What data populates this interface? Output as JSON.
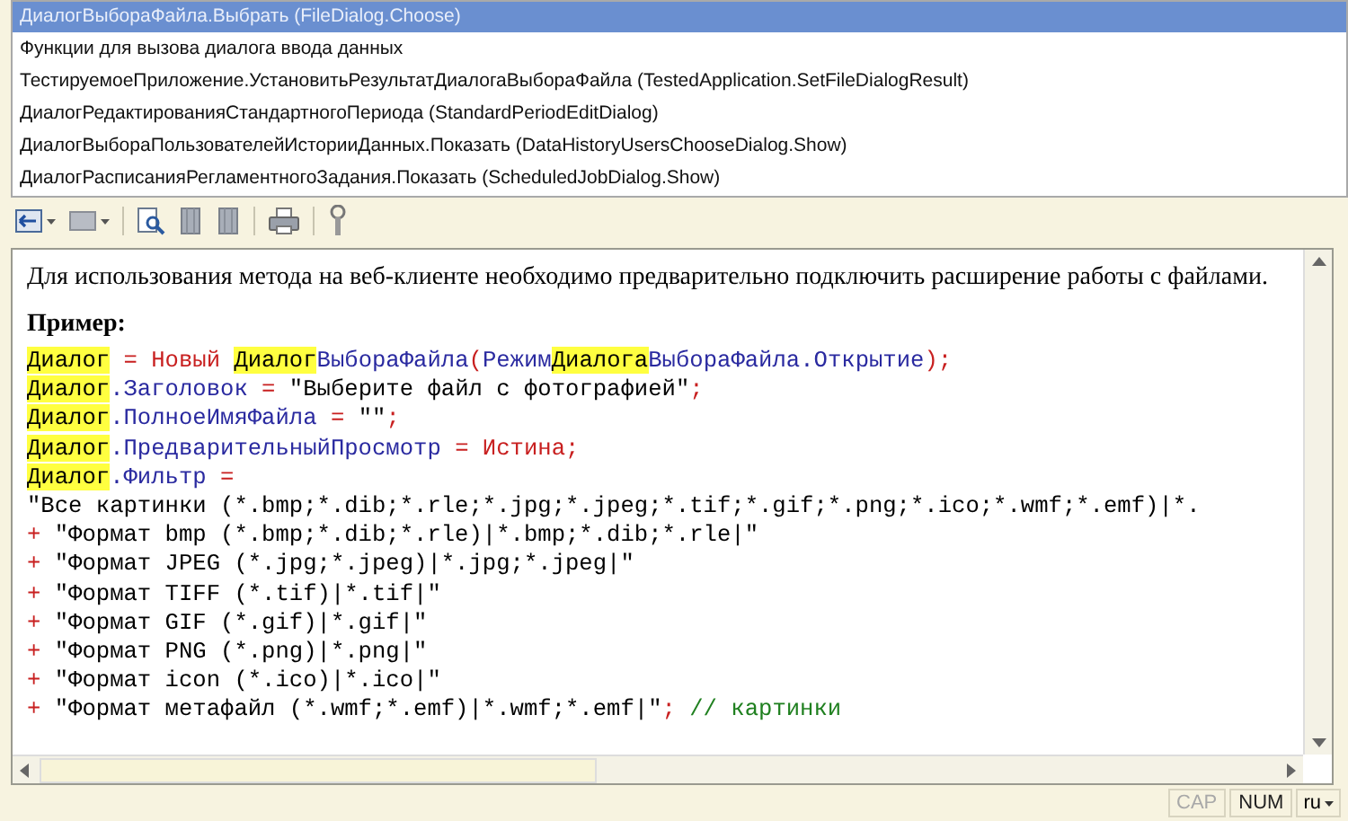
{
  "topics": [
    {
      "label": "ДиалогВыбораФайла.Выбрать (FileDialog.Choose)",
      "selected": true
    },
    {
      "label": "Функции для вызова диалога ввода данных",
      "selected": false
    },
    {
      "label": "ТестируемоеПриложение.УстановитьРезультатДиалогаВыбораФайла (TestedApplication.SetFileDialogResult)",
      "selected": false
    },
    {
      "label": "ДиалогРедактированияСтандартногоПериода (StandardPeriodEditDialog)",
      "selected": false
    },
    {
      "label": "ДиалогВыбораПользователейИсторииДанных.Показать (DataHistoryUsersChooseDialog.Show)",
      "selected": false
    },
    {
      "label": "ДиалогРасписанияРегламентногоЗадания.Показать (ScheduledJobDialog.Show)",
      "selected": false
    }
  ],
  "toolbar": [
    {
      "kind": "back",
      "dropdown": true
    },
    {
      "kind": "panel",
      "dropdown": true
    },
    {
      "kind": "search",
      "dropdown": false
    },
    {
      "kind": "book",
      "dropdown": false
    },
    {
      "kind": "book",
      "dropdown": false
    },
    {
      "kind": "print",
      "dropdown": false
    },
    {
      "kind": "tool",
      "dropdown": false
    }
  ],
  "doc": {
    "note": "Для использования метода на веб-клиенте необходимо предварительно подключить расширение работы с файлами.",
    "example_heading": "Пример:",
    "code": [
      [
        {
          "kind": "hl",
          "text": "Диалог"
        },
        {
          "kind": "kw",
          "text": " = Новый "
        },
        {
          "kind": "hl",
          "text": "Диалог"
        },
        {
          "kind": "id",
          "text": "ВыбораФайла"
        },
        {
          "kind": "kw",
          "text": "("
        },
        {
          "kind": "id",
          "text": "Режим"
        },
        {
          "kind": "hl",
          "text": "Диалога"
        },
        {
          "kind": "id",
          "text": "ВыбораФайла.Открытие"
        },
        {
          "kind": "kw",
          "text": ");"
        }
      ],
      [
        {
          "kind": "hl",
          "text": "Диалог"
        },
        {
          "kind": "id",
          "text": ".Заголовок"
        },
        {
          "kind": "kw",
          "text": " = "
        },
        {
          "kind": "str",
          "text": "\"Выберите файл с фотографией\""
        },
        {
          "kind": "kw",
          "text": ";"
        }
      ],
      [
        {
          "kind": "hl",
          "text": "Диалог"
        },
        {
          "kind": "id",
          "text": ".ПолноеИмяФайла"
        },
        {
          "kind": "kw",
          "text": " = "
        },
        {
          "kind": "str",
          "text": "\"\""
        },
        {
          "kind": "kw",
          "text": ";"
        }
      ],
      [
        {
          "kind": "hl",
          "text": "Диалог"
        },
        {
          "kind": "id",
          "text": ".ПредварительныйПросмотр"
        },
        {
          "kind": "kw",
          "text": " = Истина;"
        }
      ],
      [
        {
          "kind": "hl",
          "text": "Диалог"
        },
        {
          "kind": "id",
          "text": ".Фильтр"
        },
        {
          "kind": "kw",
          "text": " ="
        }
      ],
      [
        {
          "kind": "str",
          "text": "\"Все картинки (*.bmp;*.dib;*.rle;*.jpg;*.jpeg;*.tif;*.gif;*.png;*.ico;*.wmf;*.emf)|*."
        }
      ],
      [
        {
          "kind": "kw",
          "text": "+ "
        },
        {
          "kind": "str",
          "text": "\"Формат bmp (*.bmp;*.dib;*.rle)|*.bmp;*.dib;*.rle|\""
        }
      ],
      [
        {
          "kind": "kw",
          "text": "+ "
        },
        {
          "kind": "str",
          "text": "\"Формат JPEG (*.jpg;*.jpeg)|*.jpg;*.jpeg|\""
        }
      ],
      [
        {
          "kind": "kw",
          "text": "+ "
        },
        {
          "kind": "str",
          "text": "\"Формат TIFF (*.tif)|*.tif|\""
        }
      ],
      [
        {
          "kind": "kw",
          "text": "+ "
        },
        {
          "kind": "str",
          "text": "\"Формат GIF (*.gif)|*.gif|\""
        }
      ],
      [
        {
          "kind": "kw",
          "text": "+ "
        },
        {
          "kind": "str",
          "text": "\"Формат PNG (*.png)|*.png|\""
        }
      ],
      [
        {
          "kind": "kw",
          "text": "+ "
        },
        {
          "kind": "str",
          "text": "\"Формат icon (*.ico)|*.ico|\""
        }
      ],
      [
        {
          "kind": "kw",
          "text": "+ "
        },
        {
          "kind": "str",
          "text": "\"Формат метафайл (*.wmf;*.emf)|*.wmf;*.emf|\""
        },
        {
          "kind": "kw",
          "text": "; "
        },
        {
          "kind": "cm",
          "text": "// картинки"
        }
      ]
    ]
  },
  "status_bar": {
    "indicators": [
      {
        "label": "CAP",
        "on": false
      },
      {
        "label": "NUM",
        "on": true
      }
    ],
    "language": "ru"
  }
}
